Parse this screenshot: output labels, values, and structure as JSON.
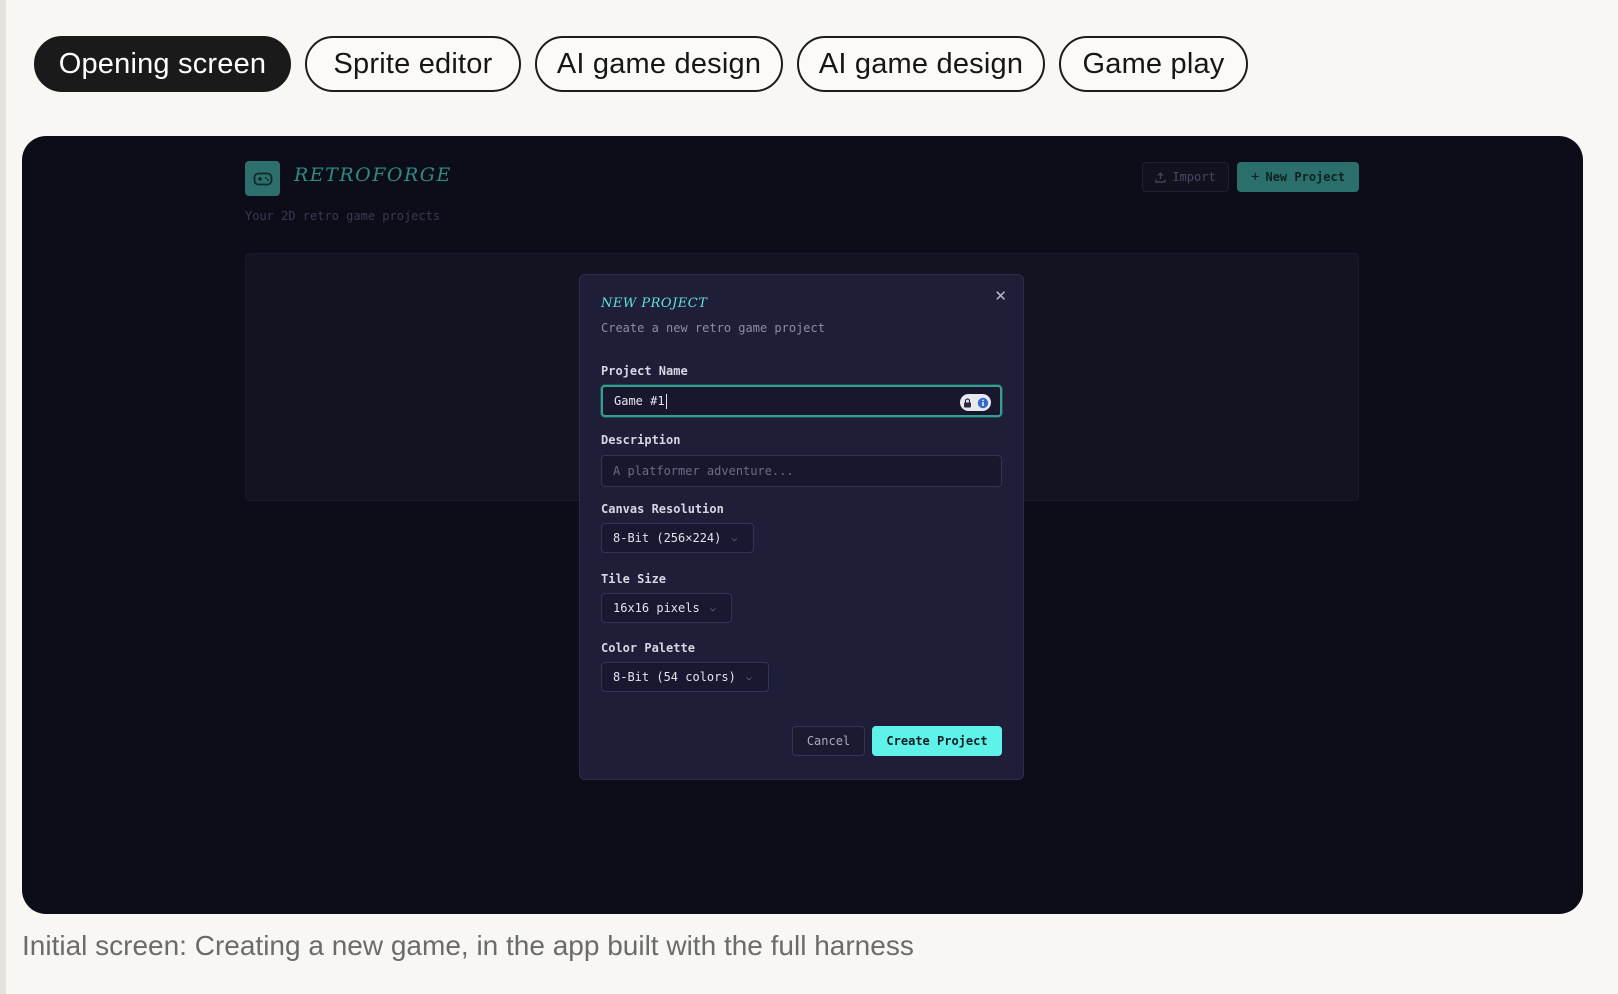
{
  "tabs": [
    {
      "label": "Opening screen",
      "active": true
    },
    {
      "label": "Sprite editor",
      "active": false
    },
    {
      "label": "AI game design",
      "active": false
    },
    {
      "label": "AI game design",
      "active": false
    },
    {
      "label": "Game play",
      "active": false
    }
  ],
  "app": {
    "logo_icon": "gamepad-icon",
    "title": "RETROFORGE",
    "subtitle": "Your 2D retro game projects",
    "import_label": "Import",
    "import_icon": "upload-icon",
    "new_project_label": "New Project",
    "new_project_icon": "plus-icon"
  },
  "modal": {
    "title": "NEW PROJECT",
    "description": "Create a new retro game project",
    "close_icon": "close-icon",
    "project_name": {
      "label": "Project Name",
      "value": "Game #1",
      "icons": [
        "lock-icon",
        "info-icon"
      ]
    },
    "description_field": {
      "label": "Description",
      "placeholder": "A platformer adventure..."
    },
    "canvas_resolution": {
      "label": "Canvas Resolution",
      "value": "8-Bit (256×224)"
    },
    "tile_size": {
      "label": "Tile Size",
      "value": "16x16 pixels"
    },
    "color_palette": {
      "label": "Color Palette",
      "value": "8-Bit (54 colors)"
    },
    "cancel_label": "Cancel",
    "create_label": "Create Project"
  },
  "colors": {
    "accent": "#5ff2e8",
    "teal_dim": "#2b6f6c",
    "modal_bg": "#1f1e38",
    "panel_bg": "#0d0d19"
  },
  "caption": "Initial screen: Creating a new game, in the app built with the full harness"
}
